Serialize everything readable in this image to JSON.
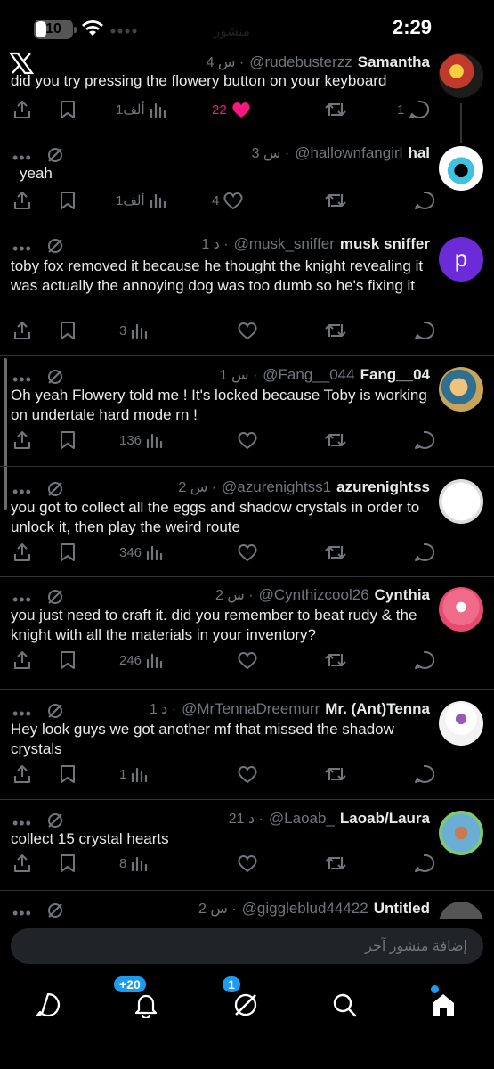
{
  "status_bar": {
    "battery": "10",
    "time": "2:29",
    "ghost_title": "منشور"
  },
  "composer": {
    "placeholder": "إضافة منشور آخر"
  },
  "nav": {
    "notifications_badge": "+20",
    "grok_badge": "1"
  },
  "colors": {
    "accent": "#1d9bf0",
    "like": "#f91880",
    "muted": "#71767b",
    "background": "#000000"
  },
  "tweets": [
    {
      "name": "Samantha",
      "handle": "@rudebusterzz",
      "time": "4 س ·",
      "text": "did you try pressing the flowery button on your keyboard",
      "views": "1ألف",
      "likes": "22",
      "retweets": "",
      "replies": "1",
      "liked": true
    },
    {
      "name": "hal",
      "handle": "@hallownfangirl",
      "time": "3 س ·",
      "text": "yeah",
      "views": "1ألف",
      "likes": "4",
      "retweets": "",
      "replies": ""
    },
    {
      "name": "musk sniffer",
      "handle": "@musk_sniffer",
      "time": "1 د ·",
      "text": "toby fox removed it because he thought the knight revealing it was actually the annoying dog was too dumb so he's fixing it",
      "views": "3",
      "likes": "",
      "retweets": "",
      "replies": "",
      "avatar_letter": "p"
    },
    {
      "name": "Fang__04",
      "handle": "@Fang__044",
      "time": "1 س ·",
      "text": "Oh yeah Flowery told me ! It's locked because Toby is working on undertale hard mode rn !",
      "views": "136",
      "likes": "",
      "retweets": "",
      "replies": ""
    },
    {
      "name": "azurenightss",
      "handle": "@azurenightss1",
      "time": "2 س ·",
      "text": "you got to collect all the eggs and shadow crystals in order to unlock it, then play the weird route",
      "views": "346",
      "likes": "",
      "retweets": "",
      "replies": ""
    },
    {
      "name": "Cynthia",
      "handle": "@Cynthizcool26",
      "time": "2 س ·",
      "text": "you just need to craft it. did you remember to beat rudy & the knight with all the materials in your inventory?",
      "views": "246",
      "likes": "",
      "retweets": "",
      "replies": ""
    },
    {
      "name": "Mr. (Ant)Tenna",
      "handle": "@MrTennaDreemurr",
      "time": "1 د ·",
      "text": "Hey look guys we got another mf that missed the shadow crystals",
      "views": "1",
      "likes": "",
      "retweets": "",
      "replies": ""
    },
    {
      "name": "Laoab/Laura",
      "handle": "@Laoab_",
      "time": "21 د ·",
      "text": "collect 15 crystal hearts",
      "views": "8",
      "likes": "",
      "retweets": "",
      "replies": ""
    },
    {
      "name": "Untitled",
      "handle": "@giggleblud44422",
      "time": "2 س ·",
      "text": "",
      "views": "",
      "likes": "",
      "retweets": "",
      "replies": ""
    }
  ]
}
